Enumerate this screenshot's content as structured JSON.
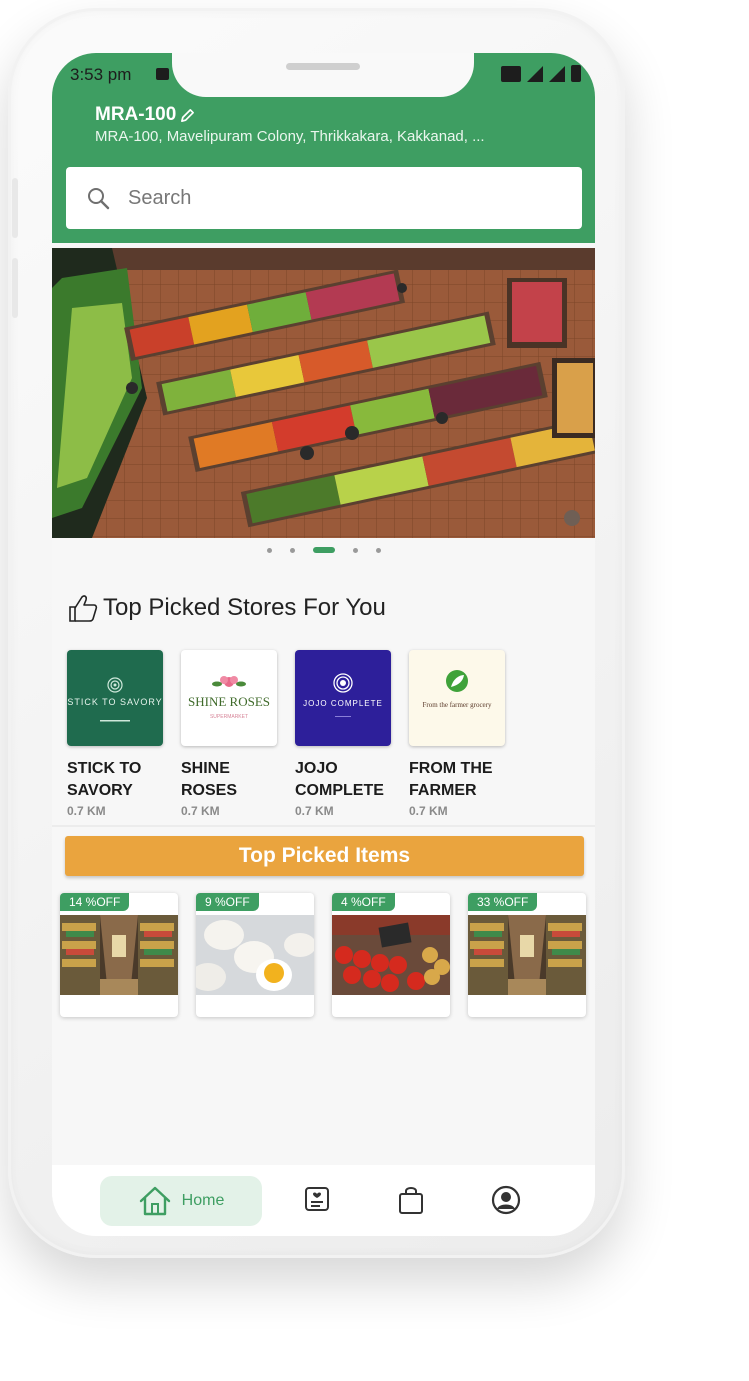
{
  "status_bar": {
    "time": "3:53 pm"
  },
  "header": {
    "location_title": "MRA-100",
    "location_address": "MRA-100, Mavelipuram Colony, Thrikkakara, Kakkanad, ..."
  },
  "search": {
    "placeholder": "Search"
  },
  "banner": {
    "slides": 5,
    "active_slide": 3
  },
  "top_stores": {
    "title": "Top Picked Stores For You",
    "stores": [
      {
        "name": "STICK TO SAVORY",
        "distance": "0.7 KM",
        "logo_text": "STICK TO SAVORY",
        "logo_color": "#1f6b4e"
      },
      {
        "name": "SHINE ROSES",
        "distance": "0.7 KM",
        "logo_text": "SHINE ROSES",
        "logo_sub": "SUPERMARKET",
        "logo_color": "#ffffff"
      },
      {
        "name": "JOJO COMPLETE",
        "distance": "0.7 KM",
        "logo_text": "JOJO COMPLETE",
        "logo_color": "#2d1f9a"
      },
      {
        "name": "FROM THE FARMER",
        "distance": "0.7 KM",
        "logo_text": "From the farmer grocery",
        "logo_color": "#fdf9ea"
      }
    ]
  },
  "top_items": {
    "title": "Top Picked Items",
    "items": [
      {
        "discount": "14 %OFF",
        "image": "grocery-aisle"
      },
      {
        "discount": "9 %OFF",
        "image": "eggs"
      },
      {
        "discount": "4 %OFF",
        "image": "tomatoes"
      },
      {
        "discount": "33 %OFF",
        "image": "grocery-aisle"
      }
    ]
  },
  "bottom_nav": {
    "items": [
      {
        "label": "Home",
        "icon": "home-icon",
        "active": true
      },
      {
        "label": "",
        "icon": "orders-icon",
        "active": false
      },
      {
        "label": "",
        "icon": "bag-icon",
        "active": false
      },
      {
        "label": "",
        "icon": "profile-icon",
        "active": false
      }
    ]
  },
  "colors": {
    "primary": "#3e9e62",
    "accent": "#eaa43e"
  }
}
